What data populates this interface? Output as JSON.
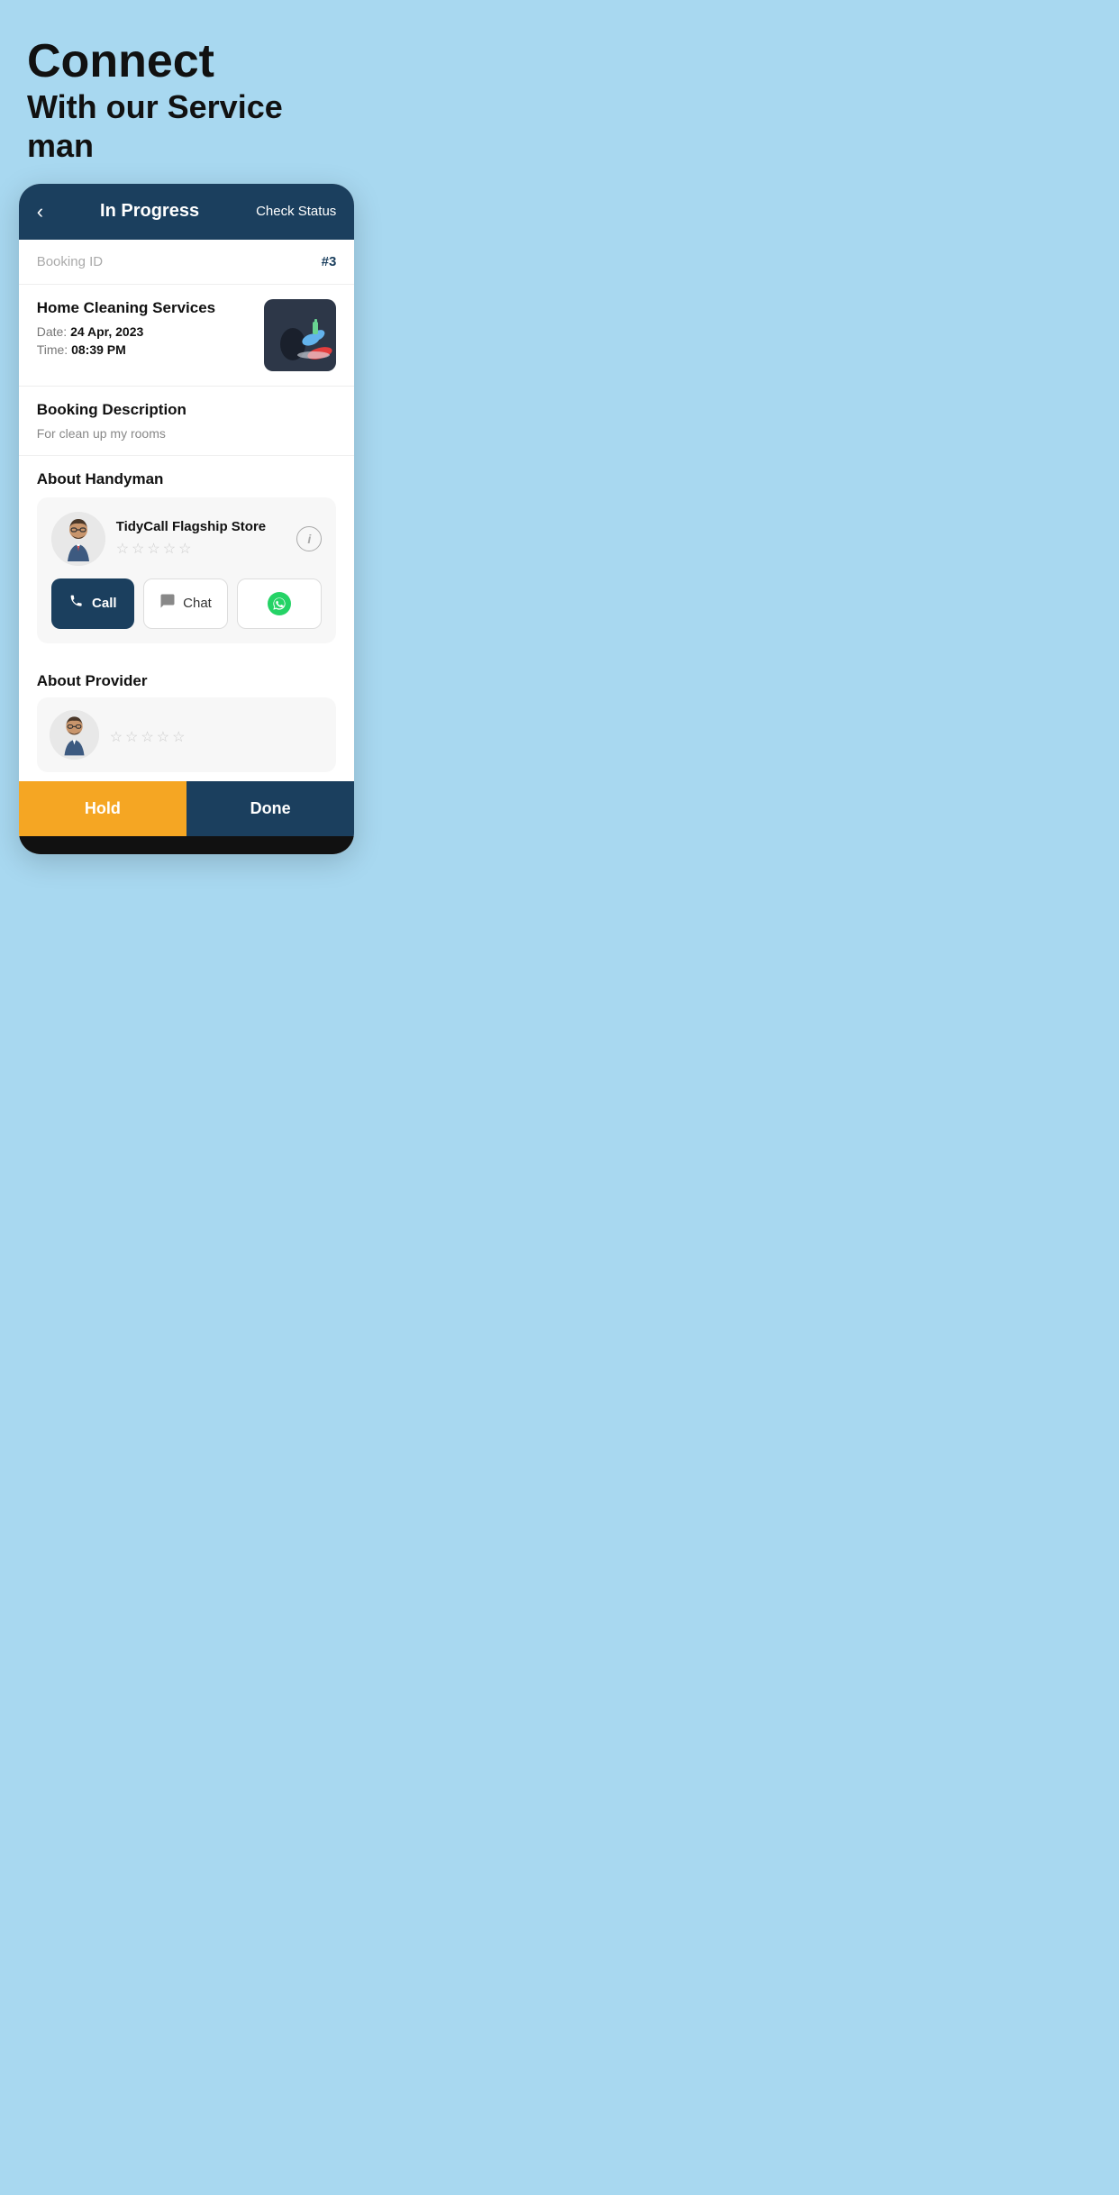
{
  "hero": {
    "title": "Connect",
    "subtitle": "With our Service man"
  },
  "header": {
    "back_arrow": "‹",
    "title": "In Progress",
    "action": "Check Status"
  },
  "booking": {
    "id_label": "Booking ID",
    "id_value": "#3",
    "service_name": "Home Cleaning Services",
    "date_label": "Date:",
    "date_value": "24 Apr, 2023",
    "time_label": "Time:",
    "time_value": "08:39 PM"
  },
  "description": {
    "title": "Booking Description",
    "text": "For clean up my rooms"
  },
  "handyman": {
    "section_title": "About Handyman",
    "name": "TidyCall Flagship Store",
    "stars": [
      "☆",
      "☆",
      "☆",
      "☆",
      "☆"
    ],
    "info_icon": "i",
    "call_label": "Call",
    "chat_label": "Chat",
    "whatsapp_label": "WhatsApp"
  },
  "provider": {
    "section_title": "About Provider"
  },
  "bottom_bar": {
    "hold_label": "Hold",
    "done_label": "Done"
  }
}
